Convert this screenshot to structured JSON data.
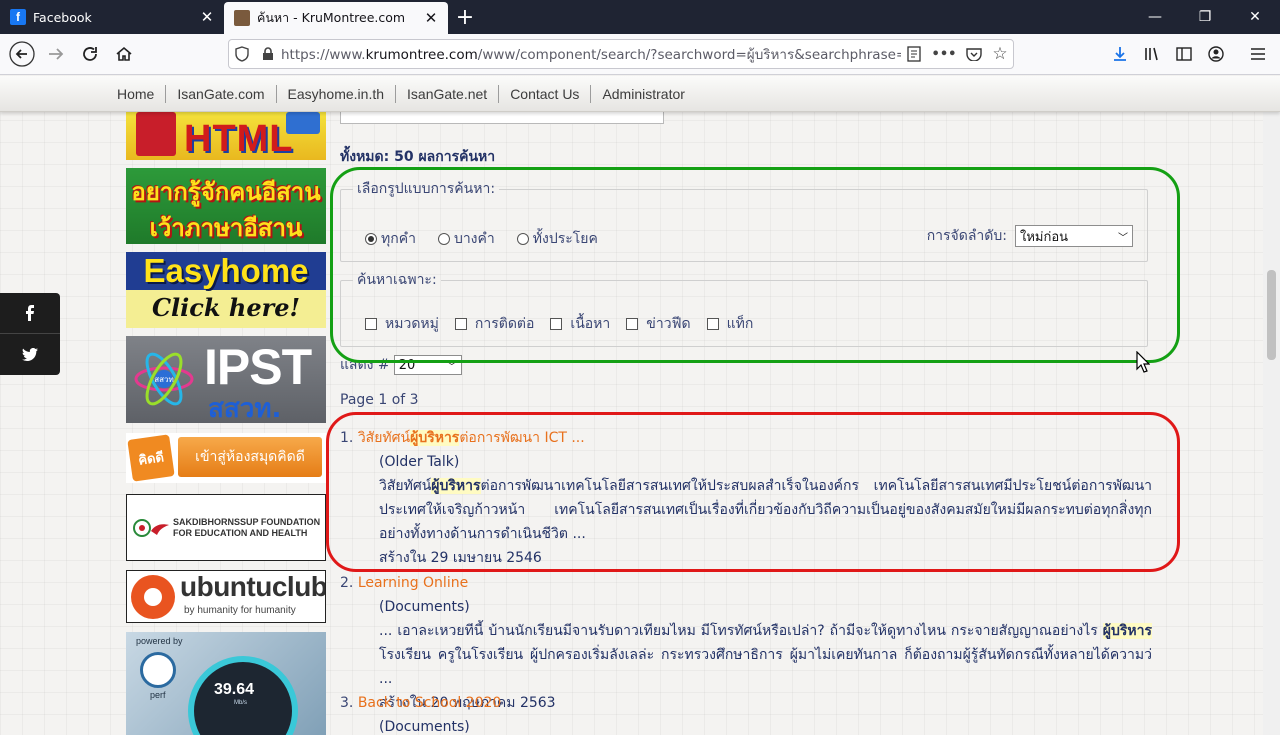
{
  "browser": {
    "tabs": [
      {
        "title": "Facebook",
        "active": false
      },
      {
        "title": "ค้นหา - KruMontree.com",
        "active": true
      }
    ],
    "url": {
      "prefix": "https://www.",
      "domain": "krumontree.com",
      "rest": "/www/component/search/?searchword=ผู้บริหาร&searchphrase=all&"
    }
  },
  "site_nav": [
    "Home",
    "IsanGate.com",
    "Easyhome.in.th",
    "IsanGate.net",
    "Contact Us",
    "Administrator"
  ],
  "banners": {
    "html": "HTML",
    "isan_line1": "อยากรู้จักคนอีสาน",
    "isan_line2": "เว้าภาษาอีสาน",
    "easy_line1": "Easyhome",
    "easy_line2": "Click here!",
    "ipst_line1": "IPST",
    "ipst_line2": "สสวท.",
    "ipst_logo": "สสวท",
    "kid_tag": "คิดดี",
    "kid_text": "เข้าสู่ห้องสมุดคิดดี",
    "sakdi_line1": "SAKDIBHORNSSUP FOUNDATION",
    "sakdi_line2": "FOR EDUCATION AND HEALTH",
    "ubuntu_line1": "ubuntuclub",
    "ubuntu_line2": "by humanity for humanity",
    "perf_powered": "powered by",
    "perf_name": "perf",
    "perf_value": "39.64",
    "perf_unit": "Mb/s"
  },
  "search": {
    "total": "ทั้งหมด: 50 ผลการค้นหา",
    "mode_legend": "เลือกรูปแบบการค้นหา:",
    "modes": [
      {
        "label": "ทุกคำ",
        "checked": true
      },
      {
        "label": "บางคำ",
        "checked": false
      },
      {
        "label": "ทั้งประโยค",
        "checked": false
      }
    ],
    "sort_label": "การจัดลำดับ:",
    "sort_value": "ใหม่ก่อน",
    "area_legend": "ค้นหาเฉพาะ:",
    "areas": [
      "หมวดหมู่",
      "การติดต่อ",
      "เนื้อหา",
      "ข่าวฟีด",
      "แท็ก"
    ],
    "limit_label": "แสดง #",
    "limit_value": "20",
    "page_info": "Page 1 of 3"
  },
  "results": [
    {
      "num": "1.",
      "title_pre": "วิสัยทัศน์",
      "title_hl": "ผู้บริหาร",
      "title_post": "ต่อการพัฒนา ICT ...",
      "category": "(Older Talk)",
      "body_pre": "วิสัยทัศน์",
      "body_hl": "ผู้บริหาร",
      "body_post": "ต่อการพัฒนาเทคโนโลยีสารสนเทศให้ประสบผลสำเร็จในองค์กร   เทคโนโลยีสารสนเทศมีประโยชน์ต่อการพัฒนาประเทศให้เจริญก้าวหน้า      เทคโนโลยีสารสนเทศเป็นเรื่องที่เกี่ยวข้องกับวิถีความเป็นอยู่ของสังคมสมัยใหม่มีผลกระทบต่อทุกสิ่งทุกอย่างทั้งทางด้านการดำเนินชีวิต ...",
      "created": "สร้างใน 29 เมษายน 2546"
    },
    {
      "num": "2.",
      "title": "Learning Online",
      "category": "(Documents)",
      "body_pre": "...  เอาละเหวยทีนี้ บ้านนักเรียนมีจานรับดาวเทียมไหม มีโทรทัศน์หรือเปล่า? ถ้ามีจะให้ดูทางไหน กระจายสัญญาณอย่างไร ",
      "body_hl": "ผู้บริหาร",
      "body_post": " โรงเรียน ครูในโรงเรียน ผู้ปกครองเริ่มลังเลล่ะ กระทรวงศึกษาธิการ ผู้มาไม่เคยทันกาล ก็ต้องถามผู้รู้สันทัดกรณีทั้งหลายได้ความว่ ...",
      "created": "สร้างใน 20 พฤษภาคม 2563"
    },
    {
      "num": "3.",
      "title": "Back to School 2020",
      "category": "(Documents)"
    }
  ],
  "colors": {
    "link": "#e8711d",
    "text": "#233266",
    "highlight": "#fffbc2",
    "annotation_green": "#14a014",
    "annotation_red": "#e01818"
  }
}
